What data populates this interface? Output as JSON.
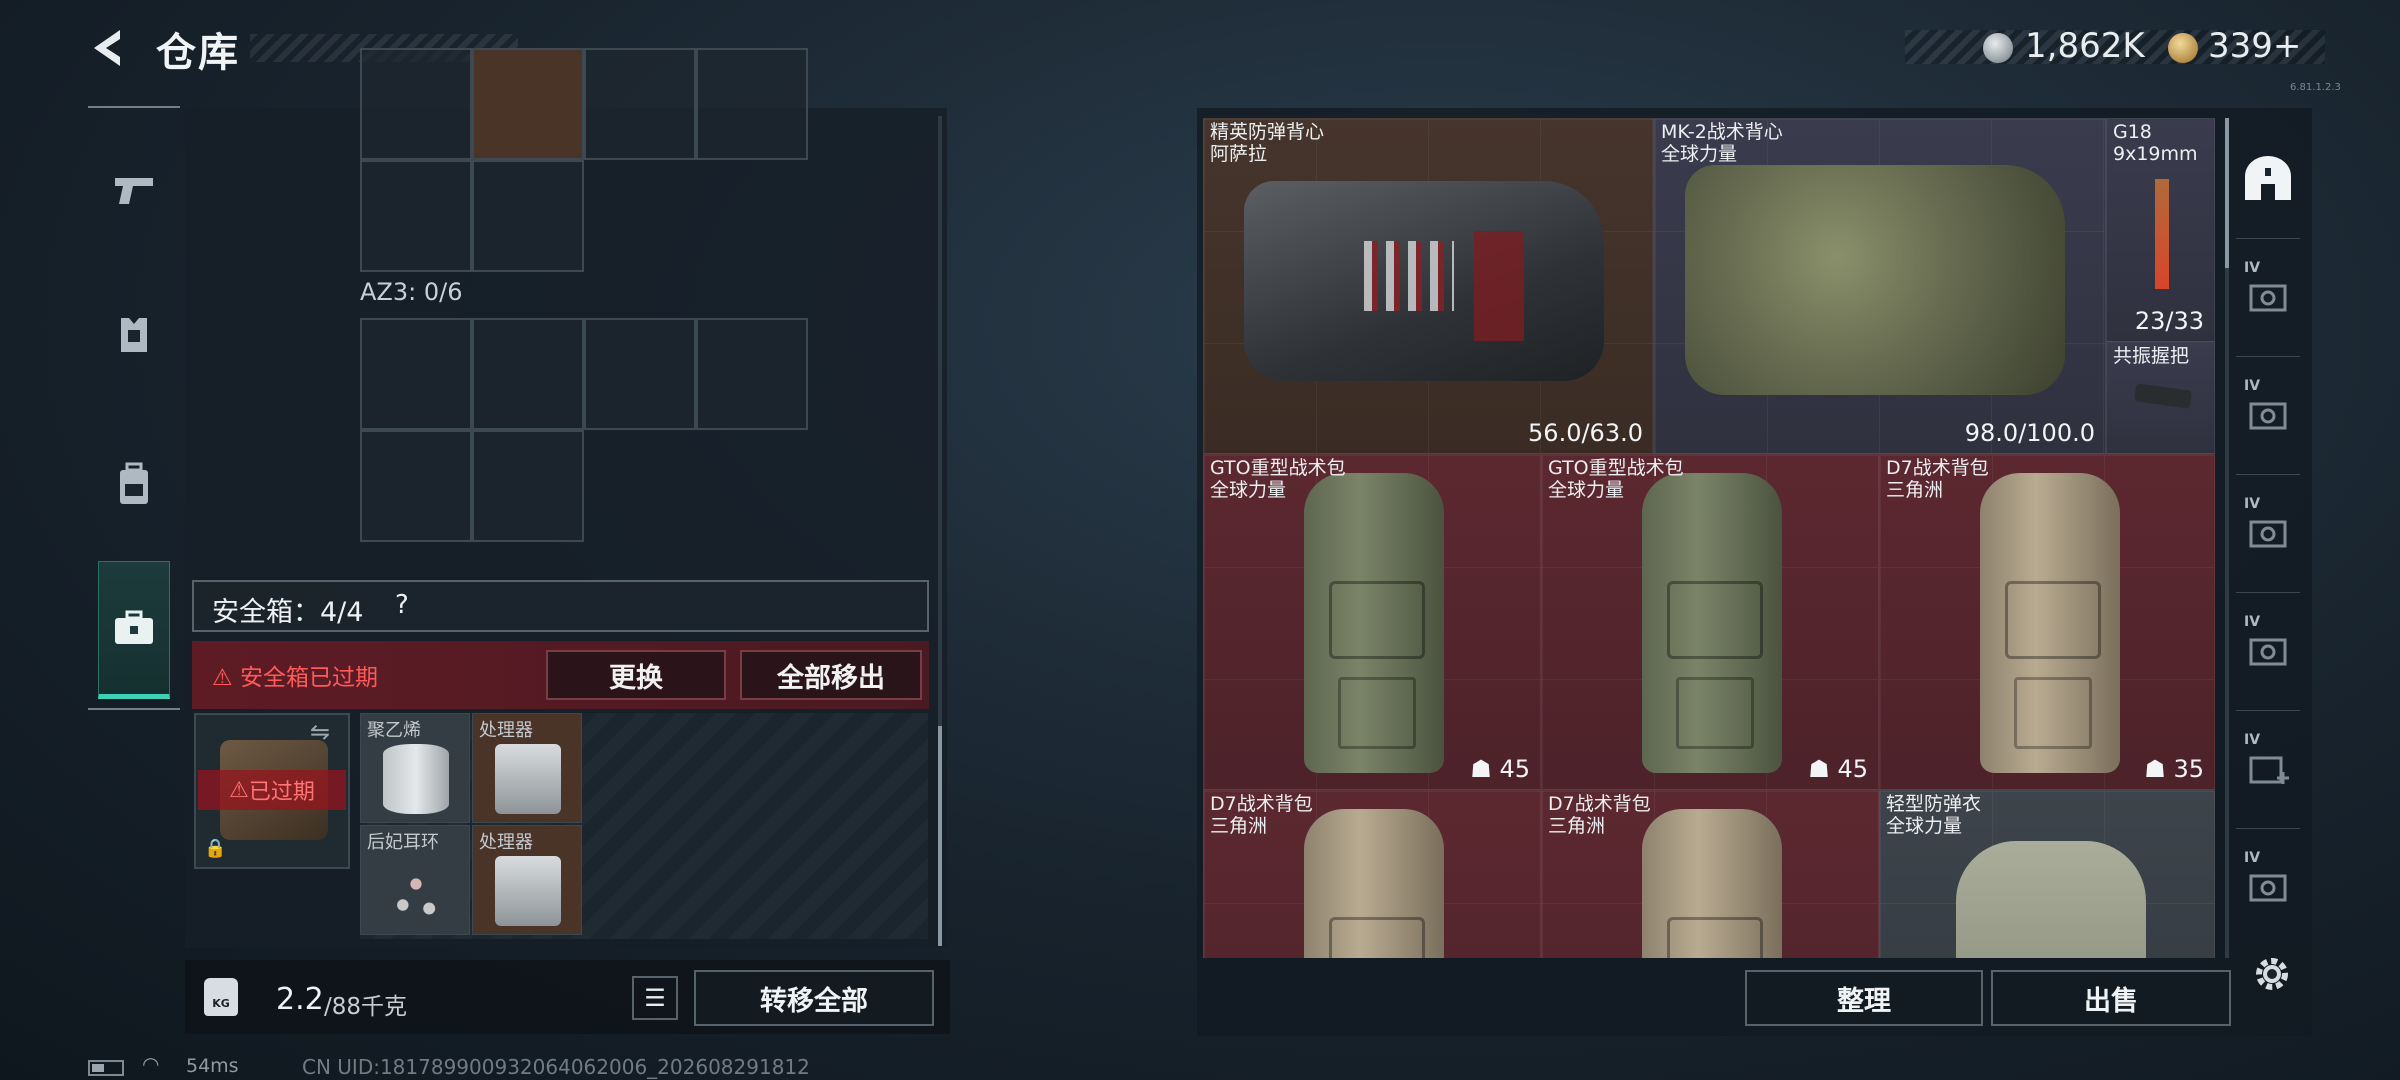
{
  "header": {
    "title": "仓库",
    "currencies": [
      {
        "icon": "silver-coin-icon",
        "value": "1,862K"
      },
      {
        "icon": "gold-coin-icon",
        "value": "339"
      }
    ],
    "add_symbol": "+",
    "version_stamp": "6.81.1.2.3"
  },
  "left_nav": {
    "items": [
      {
        "icon": "pistol-icon"
      },
      {
        "icon": "armor-icon"
      },
      {
        "icon": "backpack-icon"
      },
      {
        "icon": "safebox-icon",
        "active": true
      }
    ]
  },
  "loadout": {
    "az3_label": "AZ3: 0/6",
    "safebox_label": "安全箱：4/4",
    "help_label": "?",
    "expired_warning": "安全箱已过期",
    "replace_button": "更换",
    "move_all_button": "全部移出",
    "case_expired_label": "已过期",
    "safe_items": [
      {
        "name": "聚乙烯"
      },
      {
        "name": "处理器"
      },
      {
        "name": "后妃耳环"
      },
      {
        "name": "处理器"
      }
    ]
  },
  "footer_left": {
    "weight_icon_text": "KG",
    "weight_value": "2.2",
    "weight_unit": "/88千克",
    "transfer_all_button": "转移全部"
  },
  "status": {
    "ping": "54ms",
    "uid": "CN UID:1817899009320640620​06_202608291812"
  },
  "stash": {
    "items": [
      {
        "name": "精英防弹背心",
        "sub": "阿萨拉",
        "stat": "56.0/63.0"
      },
      {
        "name": "MK-2战术背心",
        "sub": "全球力量",
        "stat": "98.0/100.0"
      },
      {
        "name": "G18",
        "sub": "9x19mm",
        "stat": "23/33"
      },
      {
        "name": "共振握把",
        "sub": "",
        "stat": ""
      },
      {
        "name": "GTO重型战术包",
        "sub": "全球力量",
        "stat": "45"
      },
      {
        "name": "GTO重型战术包",
        "sub": "全球力量",
        "stat": "45"
      },
      {
        "name": "D7战术背包",
        "sub": "三角洲",
        "stat": "35"
      },
      {
        "name": "D7战术背包",
        "sub": "三角洲",
        "stat": ""
      },
      {
        "name": "D7战术背包",
        "sub": "三角洲",
        "stat": ""
      },
      {
        "name": "轻型防弹衣",
        "sub": "全球力量",
        "stat": ""
      }
    ],
    "sort_button": "整理",
    "sell_button": "出售"
  },
  "right_tabs": {
    "items": [
      {
        "icon": "stash-home-icon",
        "tier": ""
      },
      {
        "icon": "stash-tab-icon",
        "tier": "IV"
      },
      {
        "icon": "stash-tab-icon",
        "tier": "IV"
      },
      {
        "icon": "stash-tab-icon",
        "tier": "IV"
      },
      {
        "icon": "stash-tab-icon",
        "tier": "IV"
      },
      {
        "icon": "stash-add-icon",
        "tier": "IV"
      },
      {
        "icon": "stash-tab-icon",
        "tier": "IV"
      }
    ]
  }
}
